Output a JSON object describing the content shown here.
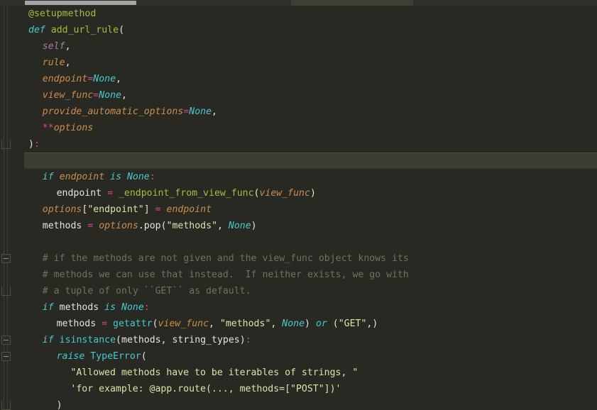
{
  "editor": {
    "language": "python",
    "theme": "monokai-dark",
    "background_color": "#282923",
    "current_line_color": "#3c3e32",
    "scrollbar": {
      "orientation": "horizontal",
      "position": "top",
      "thumb_color": "#a6a6a6"
    }
  },
  "colors": {
    "decorator": "#a6bd3c",
    "keyword": "#48c8d0",
    "function_name": "#a6bd3c",
    "self": "#b07ba8",
    "parameter": "#ce8d4a",
    "operator": "#e0457b",
    "none_literal": "#48c8d0",
    "string": "#e4e0a8",
    "comment": "#70715f",
    "plain_text": "#e4e4dc"
  },
  "code": {
    "lines": [
      {
        "indent": 1,
        "highlight": false,
        "fold": null,
        "tokens": [
          {
            "t": "deco",
            "v": "@setupmethod"
          }
        ]
      },
      {
        "indent": 1,
        "highlight": false,
        "fold": null,
        "tokens": [
          {
            "t": "kw",
            "v": "def"
          },
          {
            "t": "plain",
            "v": " "
          },
          {
            "t": "fn",
            "v": "add_url_rule"
          },
          {
            "t": "punc",
            "v": "("
          }
        ]
      },
      {
        "indent": 2,
        "highlight": false,
        "fold": null,
        "tokens": [
          {
            "t": "self",
            "v": "self"
          },
          {
            "t": "punc",
            "v": ","
          }
        ]
      },
      {
        "indent": 2,
        "highlight": false,
        "fold": null,
        "tokens": [
          {
            "t": "param",
            "v": "rule"
          },
          {
            "t": "punc",
            "v": ","
          }
        ]
      },
      {
        "indent": 2,
        "highlight": false,
        "fold": null,
        "tokens": [
          {
            "t": "param",
            "v": "endpoint"
          },
          {
            "t": "op",
            "v": "="
          },
          {
            "t": "none",
            "v": "None"
          },
          {
            "t": "punc",
            "v": ","
          }
        ]
      },
      {
        "indent": 2,
        "highlight": false,
        "fold": null,
        "tokens": [
          {
            "t": "param",
            "v": "view_func"
          },
          {
            "t": "op",
            "v": "="
          },
          {
            "t": "none",
            "v": "None"
          },
          {
            "t": "punc",
            "v": ","
          }
        ]
      },
      {
        "indent": 2,
        "highlight": false,
        "fold": null,
        "tokens": [
          {
            "t": "param",
            "v": "provide_automatic_options"
          },
          {
            "t": "op",
            "v": "="
          },
          {
            "t": "none",
            "v": "None"
          },
          {
            "t": "punc",
            "v": ","
          }
        ]
      },
      {
        "indent": 2,
        "highlight": false,
        "fold": null,
        "tokens": [
          {
            "t": "op",
            "v": "**"
          },
          {
            "t": "param",
            "v": "options"
          }
        ]
      },
      {
        "indent": 1,
        "highlight": false,
        "fold": "end",
        "tokens": [
          {
            "t": "punc",
            "v": ")"
          },
          {
            "t": "colon",
            "v": ":"
          }
        ]
      },
      {
        "indent": 0,
        "highlight": true,
        "fold": null,
        "tokens": []
      },
      {
        "indent": 2,
        "highlight": false,
        "fold": null,
        "tokens": [
          {
            "t": "kw",
            "v": "if"
          },
          {
            "t": "plain",
            "v": " "
          },
          {
            "t": "param",
            "v": "endpoint"
          },
          {
            "t": "plain",
            "v": " "
          },
          {
            "t": "kw",
            "v": "is"
          },
          {
            "t": "plain",
            "v": " "
          },
          {
            "t": "none",
            "v": "None"
          },
          {
            "t": "colon",
            "v": ":"
          }
        ]
      },
      {
        "indent": 3,
        "highlight": false,
        "fold": null,
        "tokens": [
          {
            "t": "plain",
            "v": "endpoint "
          },
          {
            "t": "op",
            "v": "="
          },
          {
            "t": "plain",
            "v": " "
          },
          {
            "t": "fn",
            "v": "_endpoint_from_view_func"
          },
          {
            "t": "punc",
            "v": "("
          },
          {
            "t": "param",
            "v": "view_func"
          },
          {
            "t": "punc",
            "v": ")"
          }
        ]
      },
      {
        "indent": 2,
        "highlight": false,
        "fold": null,
        "tokens": [
          {
            "t": "param",
            "v": "options"
          },
          {
            "t": "punc",
            "v": "["
          },
          {
            "t": "str",
            "v": "\"endpoint\""
          },
          {
            "t": "punc",
            "v": "] "
          },
          {
            "t": "op",
            "v": "="
          },
          {
            "t": "plain",
            "v": " "
          },
          {
            "t": "param",
            "v": "endpoint"
          }
        ]
      },
      {
        "indent": 2,
        "highlight": false,
        "fold": null,
        "tokens": [
          {
            "t": "plain",
            "v": "methods "
          },
          {
            "t": "op",
            "v": "="
          },
          {
            "t": "plain",
            "v": " "
          },
          {
            "t": "param",
            "v": "options"
          },
          {
            "t": "punc",
            "v": "."
          },
          {
            "t": "plain",
            "v": "pop"
          },
          {
            "t": "punc",
            "v": "("
          },
          {
            "t": "str",
            "v": "\"methods\""
          },
          {
            "t": "punc",
            "v": ", "
          },
          {
            "t": "none",
            "v": "None"
          },
          {
            "t": "punc",
            "v": ")"
          }
        ]
      },
      {
        "indent": 0,
        "highlight": false,
        "fold": null,
        "tokens": []
      },
      {
        "indent": 2,
        "highlight": false,
        "fold": "start",
        "tokens": [
          {
            "t": "comment",
            "v": "# if the methods are not given and the view_func object knows its"
          }
        ]
      },
      {
        "indent": 2,
        "highlight": false,
        "fold": null,
        "tokens": [
          {
            "t": "comment",
            "v": "# methods we can use that instead.  If neither exists, we go with"
          }
        ]
      },
      {
        "indent": 2,
        "highlight": false,
        "fold": "end",
        "tokens": [
          {
            "t": "comment",
            "v": "# a tuple of only ``GET`` as default."
          }
        ]
      },
      {
        "indent": 2,
        "highlight": false,
        "fold": null,
        "tokens": [
          {
            "t": "kw",
            "v": "if"
          },
          {
            "t": "plain",
            "v": " methods "
          },
          {
            "t": "kw",
            "v": "is"
          },
          {
            "t": "plain",
            "v": " "
          },
          {
            "t": "none",
            "v": "None"
          },
          {
            "t": "colon",
            "v": ":"
          }
        ]
      },
      {
        "indent": 3,
        "highlight": false,
        "fold": null,
        "tokens": [
          {
            "t": "plain",
            "v": "methods "
          },
          {
            "t": "op",
            "v": "="
          },
          {
            "t": "plain",
            "v": " "
          },
          {
            "t": "builtin",
            "v": "getattr"
          },
          {
            "t": "punc",
            "v": "("
          },
          {
            "t": "param",
            "v": "view_func"
          },
          {
            "t": "punc",
            "v": ", "
          },
          {
            "t": "str",
            "v": "\"methods\""
          },
          {
            "t": "punc",
            "v": ", "
          },
          {
            "t": "none",
            "v": "None"
          },
          {
            "t": "punc",
            "v": ") "
          },
          {
            "t": "kw",
            "v": "or"
          },
          {
            "t": "punc",
            "v": " ("
          },
          {
            "t": "str",
            "v": "\"GET\""
          },
          {
            "t": "punc",
            "v": ",)"
          }
        ]
      },
      {
        "indent": 2,
        "highlight": false,
        "fold": "start",
        "tokens": [
          {
            "t": "kw",
            "v": "if"
          },
          {
            "t": "plain",
            "v": " "
          },
          {
            "t": "builtin",
            "v": "isinstance"
          },
          {
            "t": "punc",
            "v": "("
          },
          {
            "t": "plain",
            "v": "methods, string_types"
          },
          {
            "t": "punc",
            "v": ")"
          },
          {
            "t": "colon",
            "v": ":"
          }
        ]
      },
      {
        "indent": 3,
        "highlight": false,
        "fold": "start",
        "tokens": [
          {
            "t": "kw",
            "v": "raise"
          },
          {
            "t": "plain",
            "v": " "
          },
          {
            "t": "class",
            "v": "TypeError"
          },
          {
            "t": "punc",
            "v": "("
          }
        ]
      },
      {
        "indent": 4,
        "highlight": false,
        "fold": null,
        "tokens": [
          {
            "t": "str",
            "v": "\"Allowed methods have to be iterables of strings, \""
          }
        ]
      },
      {
        "indent": 4,
        "highlight": false,
        "fold": null,
        "tokens": [
          {
            "t": "str",
            "v": "'for example: @app.route(..., methods=[\"POST\"])'"
          }
        ]
      },
      {
        "indent": 3,
        "highlight": false,
        "fold": "end",
        "tokens": [
          {
            "t": "punc",
            "v": ")"
          }
        ]
      }
    ]
  }
}
